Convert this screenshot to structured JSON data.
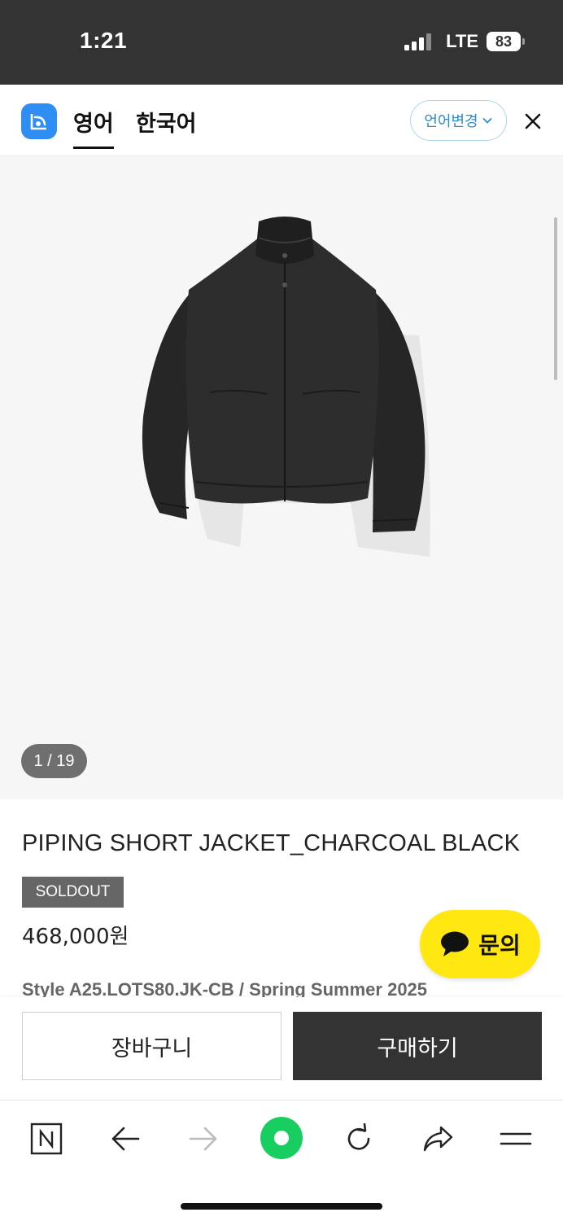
{
  "status_bar": {
    "time": "1:21",
    "network": "LTE",
    "battery": "83"
  },
  "translate_bar": {
    "tab_source": "영어",
    "tab_target": "한국어",
    "language_change": "언어변경",
    "icons": [
      "translate-logo-icon",
      "chevron-down-icon",
      "close-icon"
    ]
  },
  "gallery": {
    "counter": "1 / 19",
    "image": "black-jacket-product-photo"
  },
  "product": {
    "title": "PIPING SHORT JACKET_CHARCOAL BLACK",
    "badge": "SOLDOUT",
    "price": "468,000원",
    "style_line": "Style A25.LOTS80.JK-CB / Spring Summer 2025"
  },
  "inquiry": {
    "label": "문의",
    "color": "#ffe812"
  },
  "purchase_bar": {
    "cart_label": "장바구니",
    "buy_label": "구매하기"
  },
  "browser_toolbar": {
    "icons": [
      "naver-home-icon",
      "back-arrow-icon",
      "forward-arrow-icon",
      "green-dot-icon",
      "reload-icon",
      "share-icon",
      "menu-icon"
    ],
    "accent": "#19ce60"
  }
}
